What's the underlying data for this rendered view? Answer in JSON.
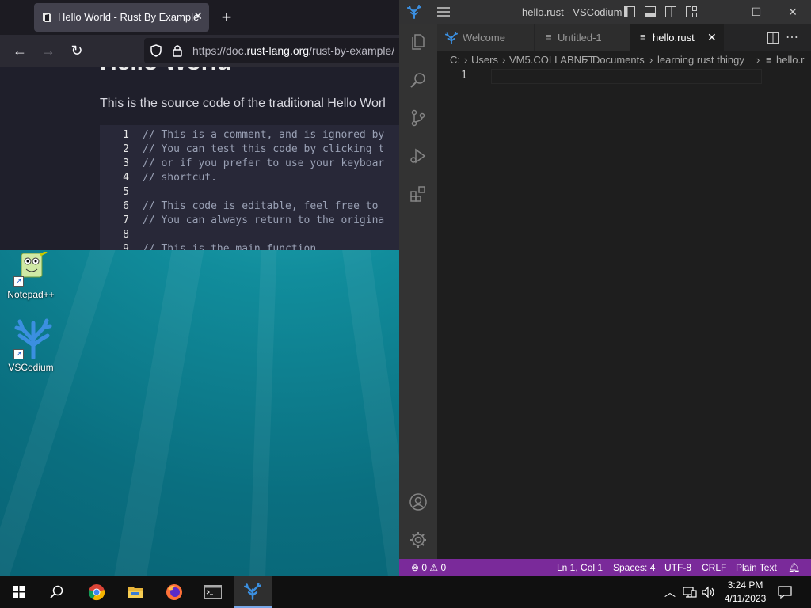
{
  "desktop": {
    "icons": [
      {
        "label": "Notepad++"
      },
      {
        "label": "VSCodium"
      }
    ]
  },
  "browser": {
    "tab": {
      "title": "Hello World - Rust By Example"
    },
    "url": {
      "prefix": "https://doc.",
      "domain": "rust-lang.org",
      "path": "/rust-by-example/"
    },
    "page": {
      "heading": "Hello World",
      "intro": "This is the source code of the traditional Hello Worl",
      "code_lines": [
        {
          "n": "1",
          "text": "// This is a comment, and is ignored by"
        },
        {
          "n": "2",
          "text": "// You can test this code by clicking t"
        },
        {
          "n": "3",
          "text": "// or if you prefer to use your keyboar"
        },
        {
          "n": "4",
          "text": "// shortcut."
        },
        {
          "n": "5",
          "text": ""
        },
        {
          "n": "6",
          "text": "// This code is editable, feel free to"
        },
        {
          "n": "7",
          "text": "// You can always return to the origina"
        },
        {
          "n": "8",
          "text": ""
        },
        {
          "n": "9",
          "text": "// This is the main function."
        }
      ]
    }
  },
  "vscode": {
    "title": "hello.rust - VSCodium",
    "tabs": [
      {
        "label": "Welcome"
      },
      {
        "label": "Untitled-1"
      },
      {
        "label": "hello.rust"
      }
    ],
    "breadcrumb": [
      "C:",
      "Users",
      "VM5.COLLABNET",
      "Documents",
      "learning rust thingy",
      "hello.r"
    ],
    "editor": {
      "line_number": "1"
    },
    "status": {
      "errors": "0",
      "warnings": "0",
      "position": "Ln 1, Col 1",
      "spaces": "Spaces: 4",
      "encoding": "UTF-8",
      "eol": "CRLF",
      "language": "Plain Text"
    },
    "accent": "#7a2a9a"
  },
  "taskbar": {
    "time": "3:24 PM",
    "date": "4/11/2023"
  }
}
